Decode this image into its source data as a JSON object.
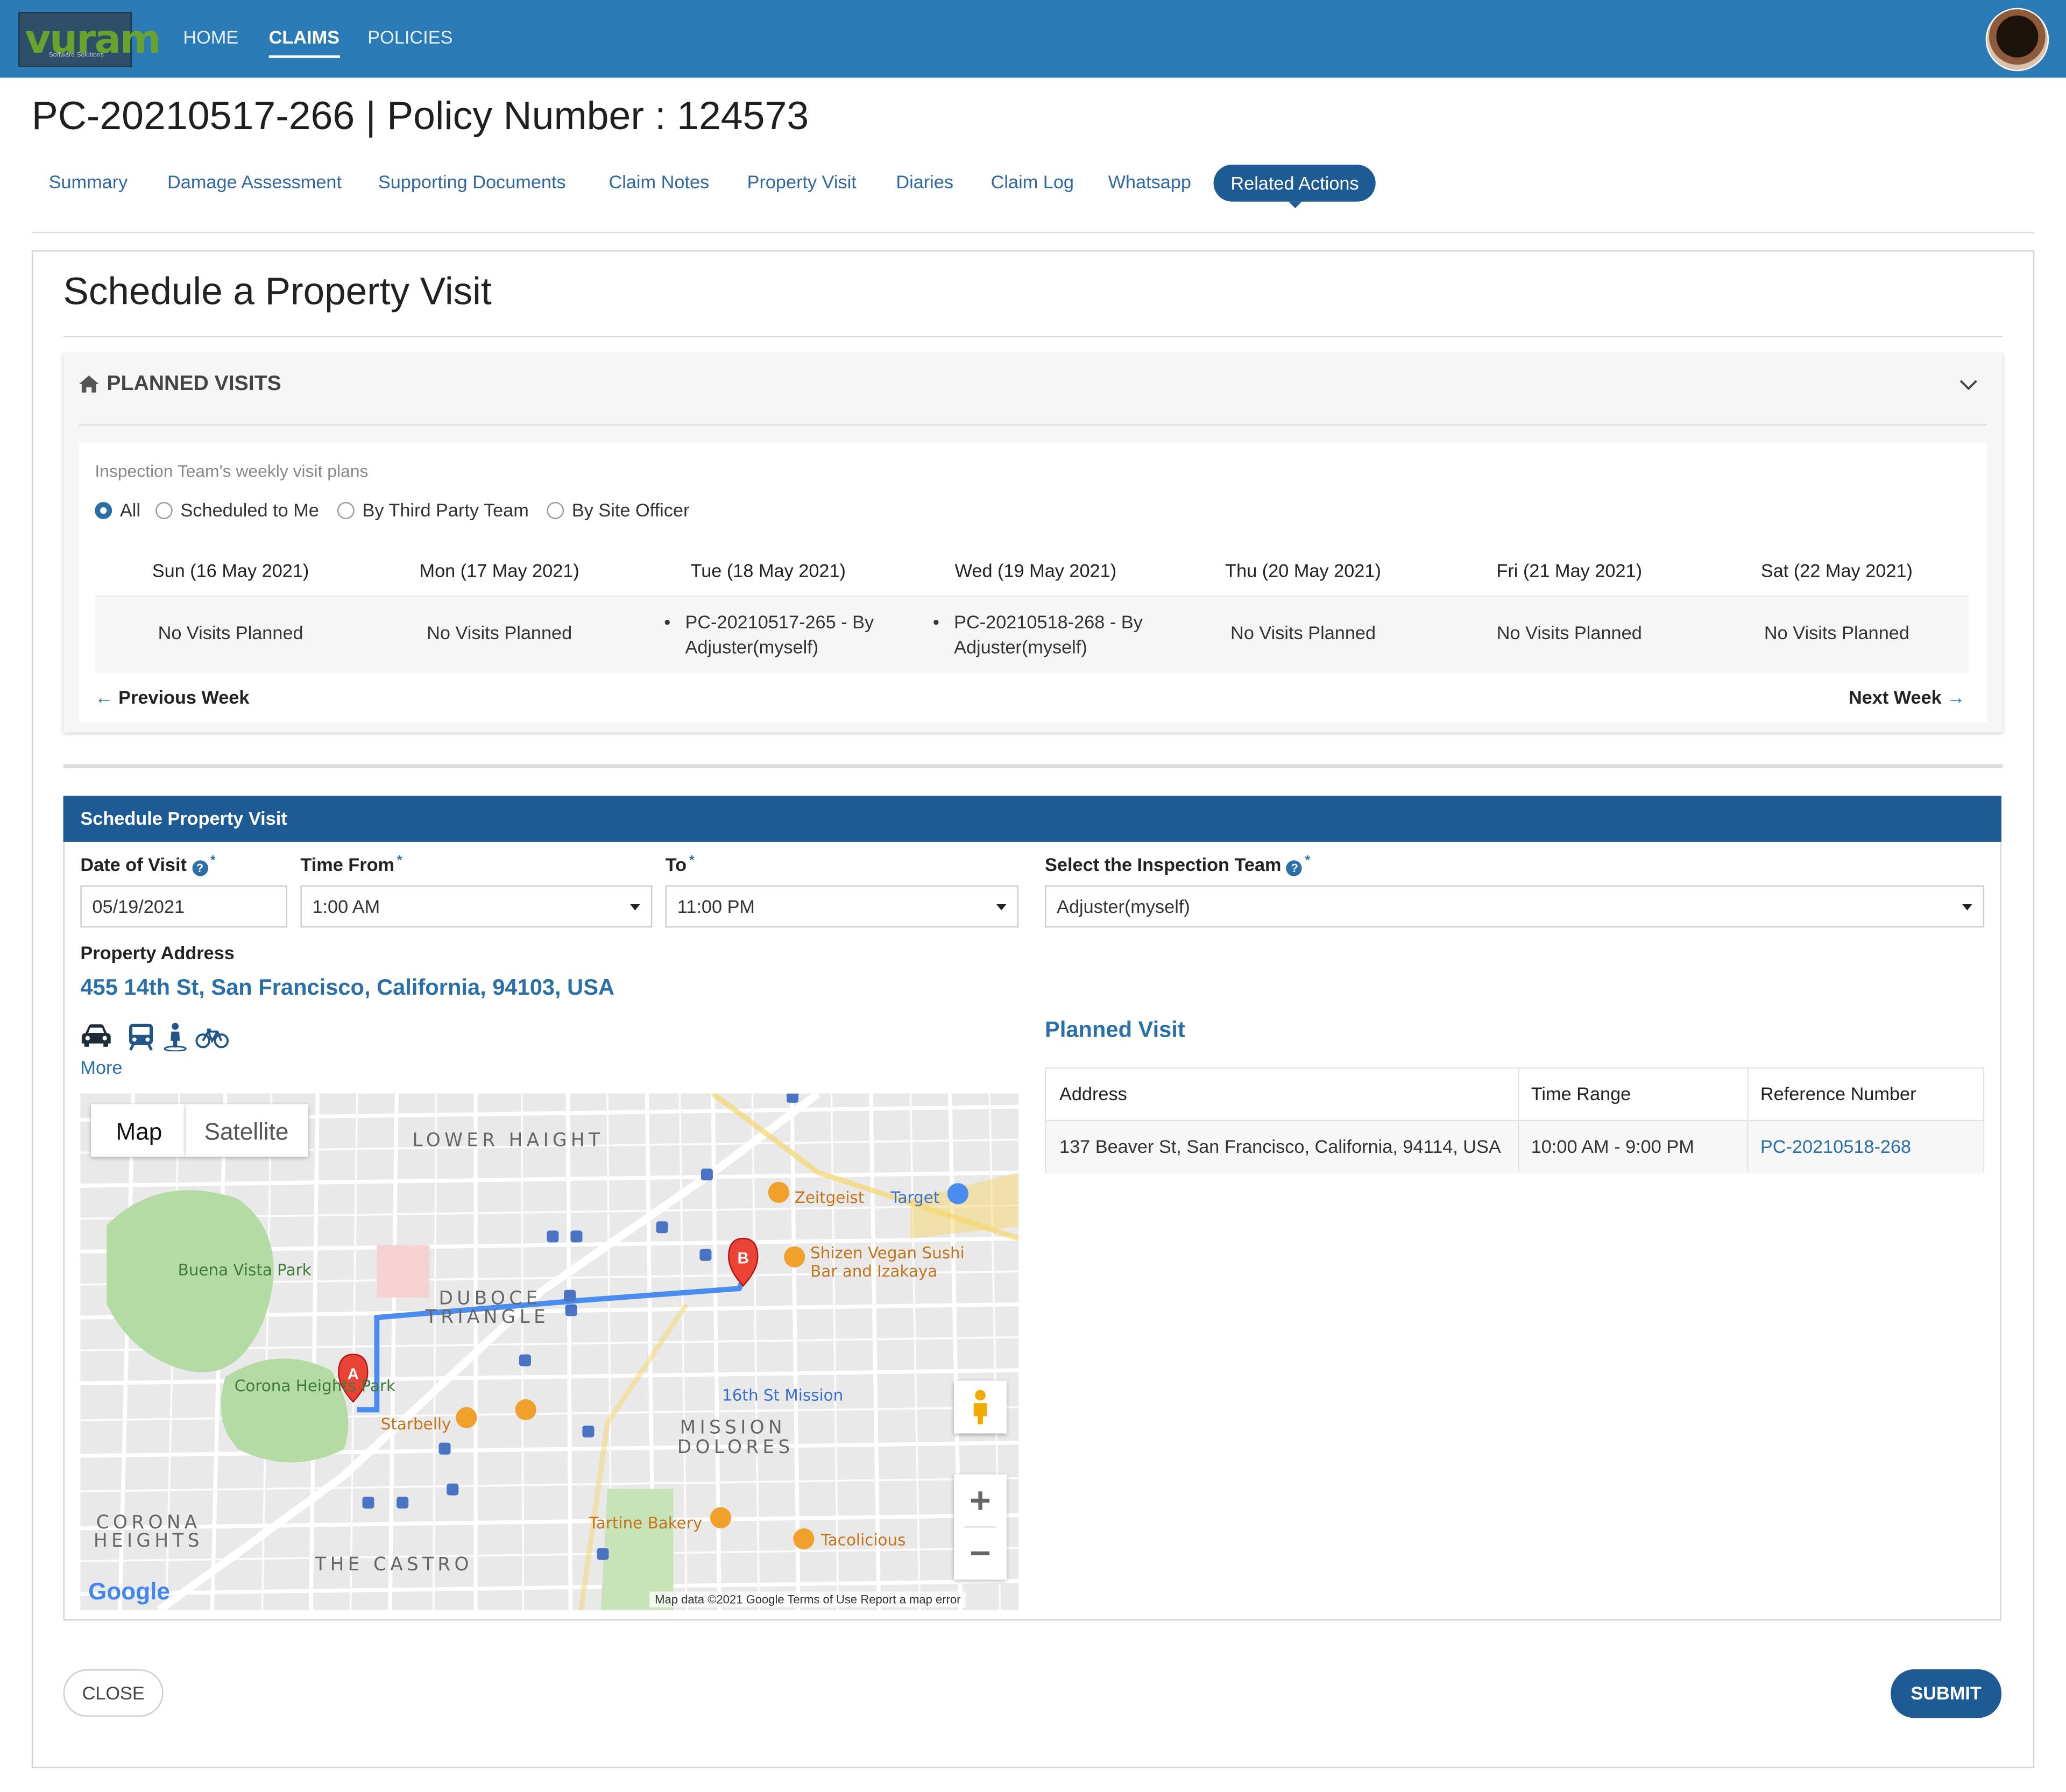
{
  "brand": {
    "logo_text": "vuram",
    "logo_sub": "Software Solutions"
  },
  "nav": {
    "items": [
      "HOME",
      "CLAIMS",
      "POLICIES"
    ],
    "active": "CLAIMS"
  },
  "claim": {
    "title": "PC-20210517-266 | Policy Number : 124573"
  },
  "tabs": [
    "Summary",
    "Damage Assessment",
    "Supporting Documents",
    "Claim Notes",
    "Property Visit",
    "Diaries",
    "Claim Log",
    "Whatsapp",
    "Related Actions"
  ],
  "active_tab": "Related Actions",
  "page_title": "Schedule a Property Visit",
  "planned_visits": {
    "heading": "PLANNED VISITS",
    "subtitle": "Inspection Team's weekly visit plans",
    "filters": [
      "All",
      "Scheduled to Me",
      "By Third Party Team",
      "By Site Officer"
    ],
    "selected_filter": "All",
    "days": [
      {
        "label": "Sun (16 May 2021)",
        "value": "No Visits Planned"
      },
      {
        "label": "Mon (17 May 2021)",
        "value": "No Visits Planned"
      },
      {
        "label": "Tue (18 May 2021)",
        "value": "PC-20210517-265 - By Adjuster(myself)"
      },
      {
        "label": "Wed (19 May 2021)",
        "value": "PC-20210518-268 - By Adjuster(myself)"
      },
      {
        "label": "Thu (20 May 2021)",
        "value": "No Visits Planned"
      },
      {
        "label": "Fri (21 May 2021)",
        "value": "No Visits Planned"
      },
      {
        "label": "Sat (22 May 2021)",
        "value": "No Visits Planned"
      }
    ],
    "prev_week": "Previous Week",
    "next_week": "Next Week"
  },
  "schedule": {
    "heading": "Schedule Property Visit",
    "date_label": "Date of Visit",
    "date_value": "05/19/2021",
    "time_from_label": "Time From",
    "time_from_value": "1:00 AM",
    "to_label": "To",
    "to_value": "11:00 PM",
    "team_label": "Select the Inspection Team",
    "team_value": "Adjuster(myself)",
    "address_label": "Property Address",
    "address": "455 14th St, San Francisco, California, 94103, USA",
    "more": "More"
  },
  "map": {
    "tab_map": "Map",
    "tab_satellite": "Satellite",
    "labels": {
      "lower_haight": "LOWER HAIGHT",
      "duboce": "DUBOCE",
      "triangle": "TRIANGLE",
      "buena_vista": "Buena Vista Park",
      "corona_park": "Corona Heights Park",
      "mission_dolores_1": "MISSION",
      "mission_dolores_2": "DOLORES",
      "corona_heights_1": "CORONA",
      "corona_heights_2": "HEIGHTS",
      "castro": "THE CASTRO",
      "zeitgeist": "Zeitgeist",
      "target": "Target",
      "shizen_1": "Shizen Vegan Sushi",
      "shizen_2": "Bar and Izakaya",
      "starbelly": "Starbelly",
      "tartine": "Tartine Bakery",
      "tacolicious": "Tacolicious",
      "mission16": "16th St Mission",
      "pin_a": "A",
      "pin_b": "B"
    },
    "footer": "Map data ©2021 Google   Terms of Use   Report a map error",
    "google": "Google"
  },
  "planned_visit_table": {
    "title": "Planned Visit",
    "headers": [
      "Address",
      "Time Range",
      "Reference Number"
    ],
    "rows": [
      [
        "137 Beaver St, San Francisco, California, 94114, USA",
        "10:00 AM - 9:00 PM",
        "PC-20210518-268"
      ]
    ]
  },
  "buttons": {
    "close": "CLOSE",
    "submit": "SUBMIT"
  },
  "colors": {
    "primary": "#1e5a93",
    "topbar": "#2a7ab6",
    "link": "#2a6fa8"
  }
}
